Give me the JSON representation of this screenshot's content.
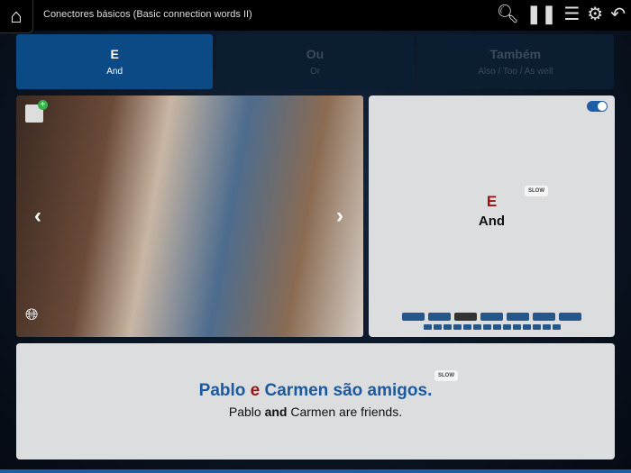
{
  "header": {
    "title": "Conectores básicos (Basic connection words II)"
  },
  "tabs": [
    {
      "word": "E",
      "translation": "And",
      "active": true
    },
    {
      "word": "Ou",
      "translation": "Or",
      "active": false
    },
    {
      "word": "Também",
      "translation": "Also / Too / As well",
      "active": false
    }
  ],
  "card": {
    "word": "E",
    "translation": "And",
    "slow_label": "SLOW",
    "progress": {
      "total_large": 7,
      "current_large": 3,
      "total_small": 14
    }
  },
  "sentence": {
    "pt_before": "Pablo ",
    "pt_highlight": "e",
    "pt_after": " Carmen são amigos.",
    "en_before": "Pablo ",
    "en_highlight": "and",
    "en_after": " Carmen are friends.",
    "slow_label": "SLOW"
  }
}
